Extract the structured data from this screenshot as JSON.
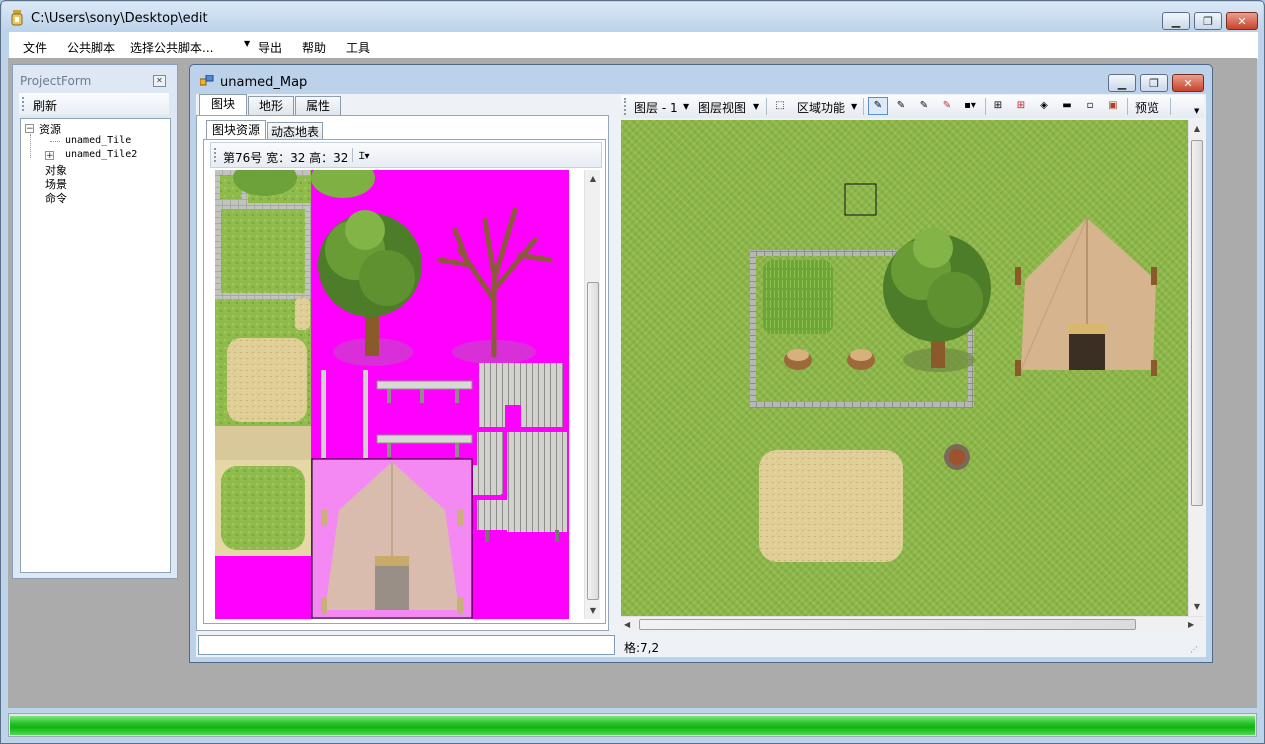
{
  "window": {
    "title": "C:\\Users\\sony\\Desktop\\edit"
  },
  "menu": {
    "file": "文件",
    "public_script": "公共脚本",
    "script_select": "选择公共脚本...",
    "export": "导出",
    "help": "帮助",
    "tools": "工具"
  },
  "project_form": {
    "title": "ProjectForm",
    "refresh": "刷新",
    "tree": {
      "resources": "资源",
      "tile1": "unamed_Tile",
      "tile2": "unamed_Tile2",
      "objects": "对象",
      "scenes": "场景",
      "commands": "命令"
    }
  },
  "map_window": {
    "title": "unamed_Map",
    "tabs": {
      "tile": "图块",
      "terrain": "地形",
      "properties": "属性"
    },
    "subtabs": {
      "tile_resources": "图块资源",
      "dynamic": "动态地表"
    },
    "tile_info": "第76号 宽：32 高：32",
    "toolbar": {
      "layer": "图层 - 1",
      "layer_view": "图层视图",
      "area_function": "区域功能",
      "preview": "预览"
    },
    "status_coord": "格:7,2"
  },
  "progress": {
    "value": 1.0
  },
  "colors": {
    "magenta": "#ff00ff",
    "grass": "#8db84a",
    "progress_green": "#22c322"
  }
}
